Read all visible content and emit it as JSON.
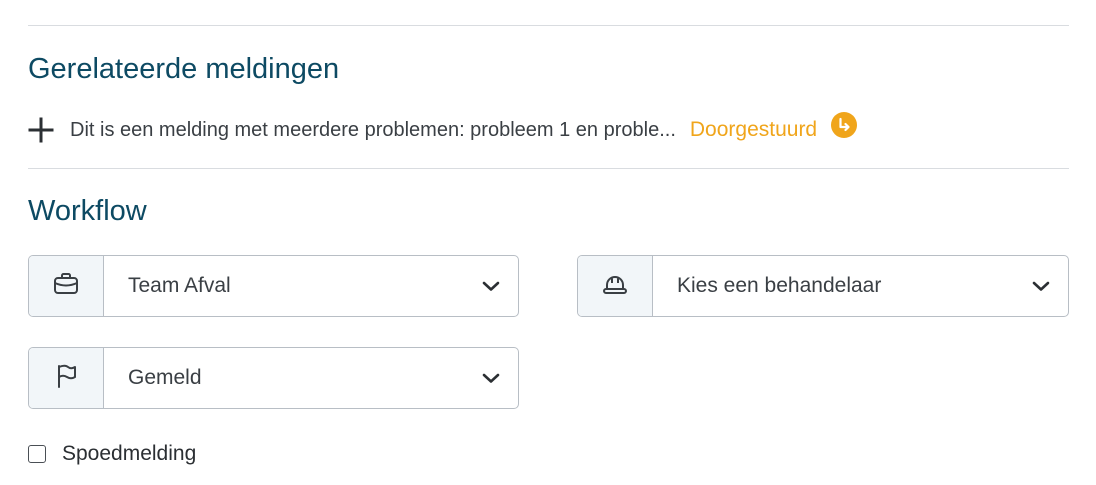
{
  "related": {
    "title": "Gerelateerde meldingen",
    "item_text": "Dit is een melding met meerdere problemen: probleem 1 en proble...",
    "item_status": "Doorgestuurd",
    "add_icon": "plus-icon",
    "status_icon": "forward-arrow-icon"
  },
  "workflow": {
    "title": "Workflow",
    "team_select": {
      "icon": "briefcase-icon",
      "value": "Team Afval"
    },
    "handler_select": {
      "icon": "hard-hat-icon",
      "value": "Kies een behandelaar"
    },
    "status_select": {
      "icon": "flag-icon",
      "value": "Gemeld"
    },
    "urgent_checkbox": {
      "label": "Spoedmelding",
      "checked": false
    }
  },
  "colors": {
    "title": "#0d4a63",
    "status": "#f0a51b",
    "border": "#b8bec5",
    "icon_box_bg": "#f2f6f9"
  }
}
